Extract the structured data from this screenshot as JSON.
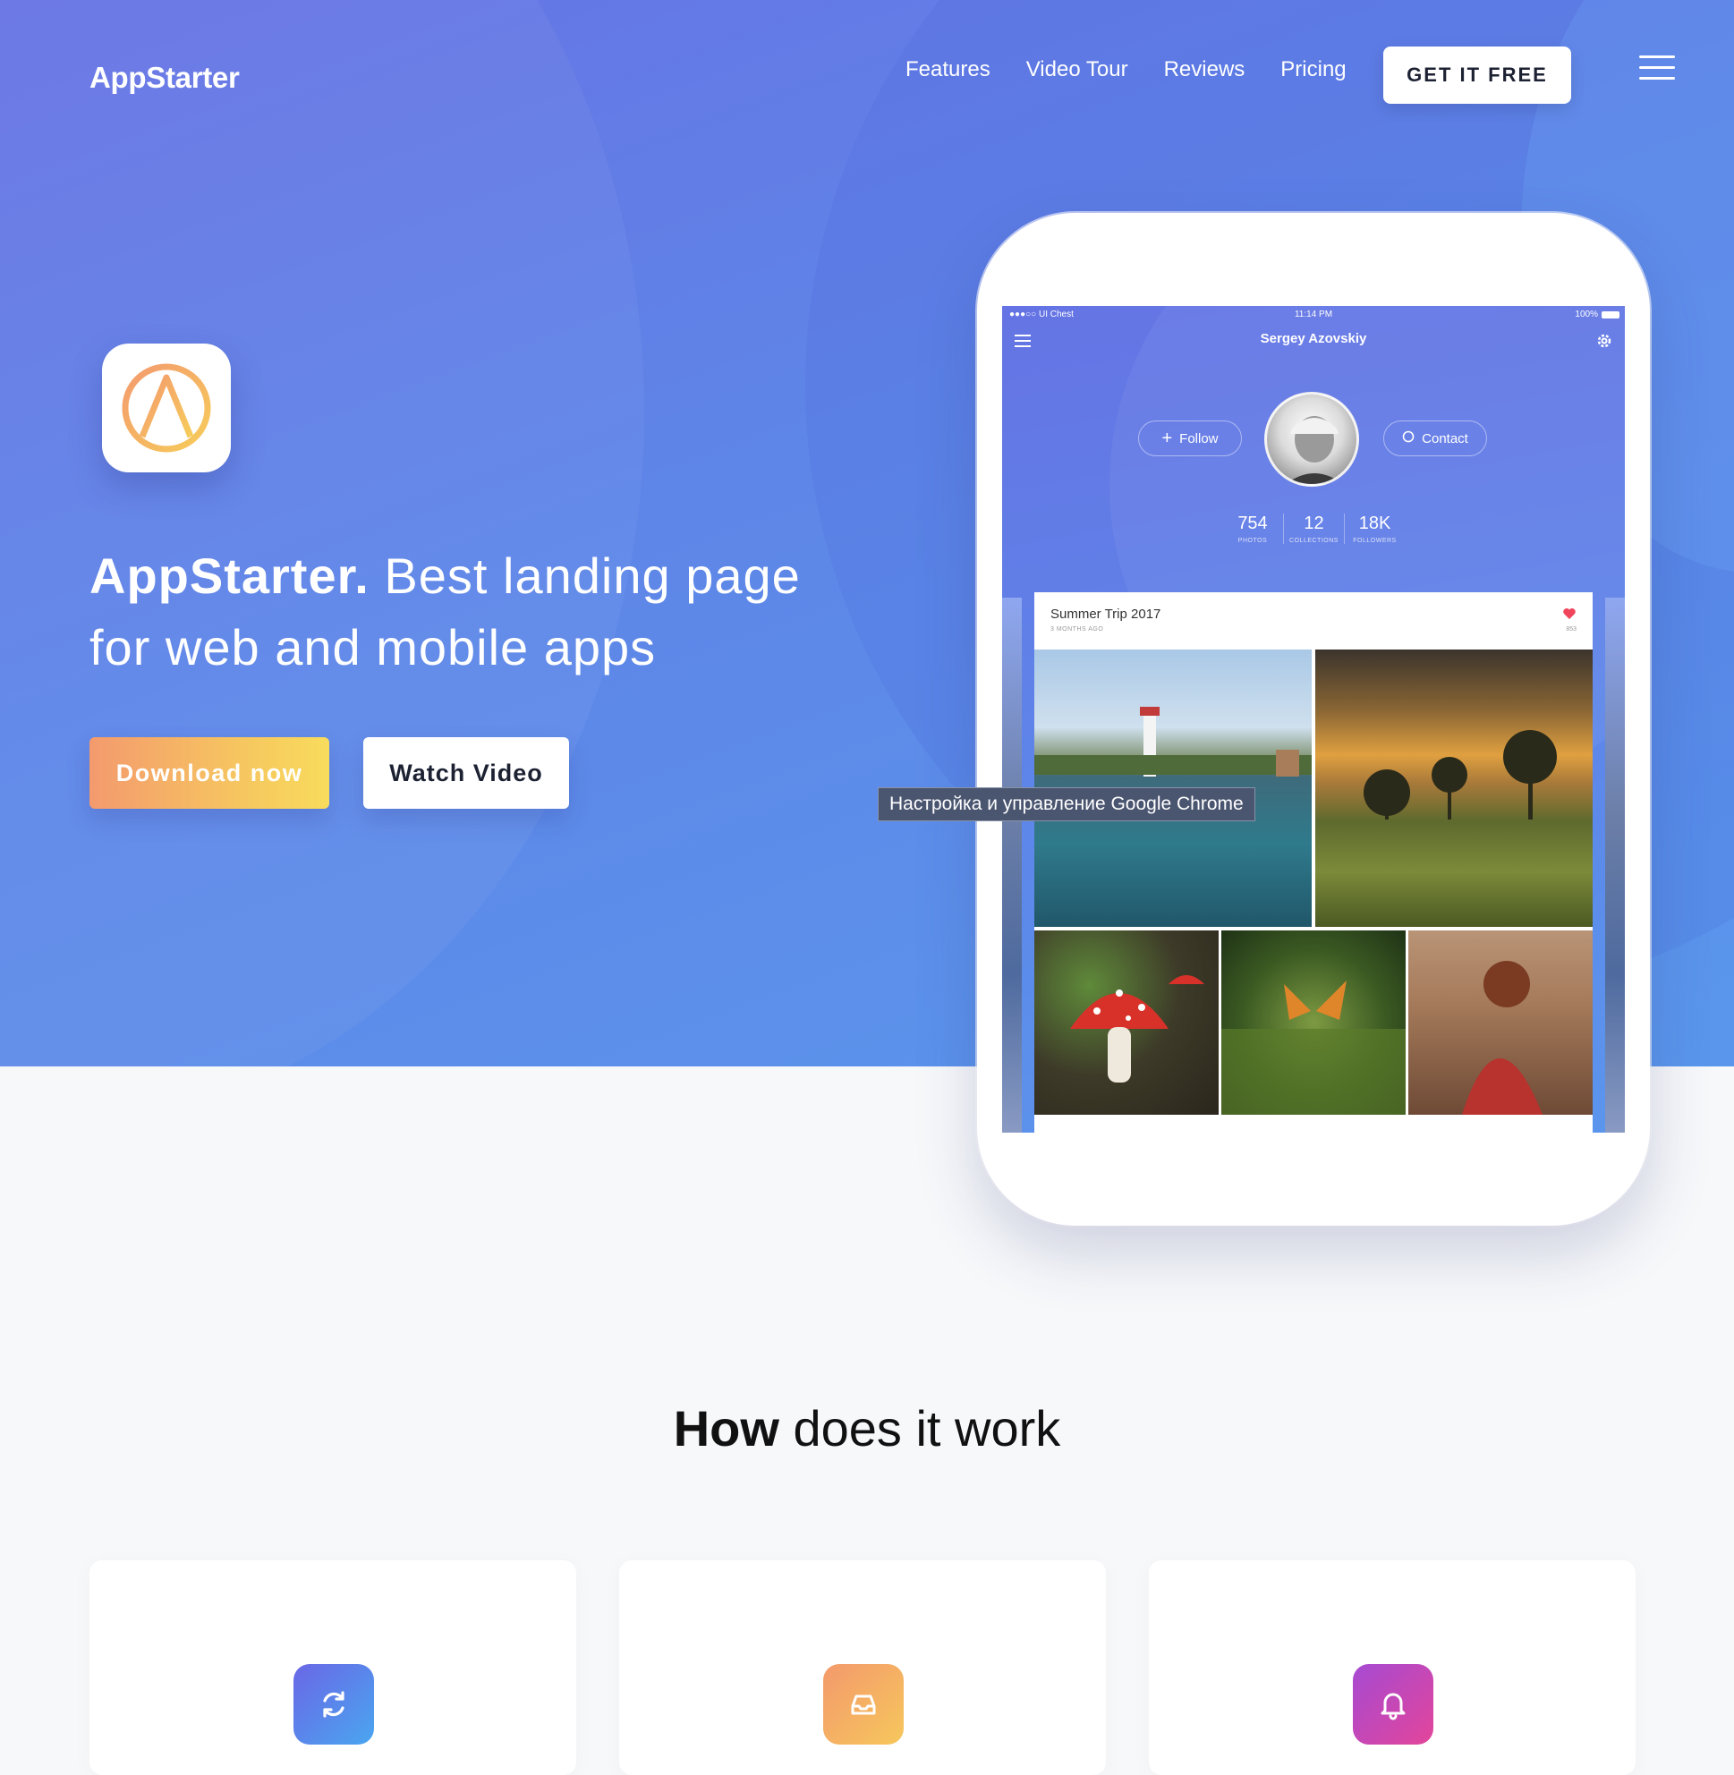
{
  "nav": {
    "logo": "AppStarter",
    "links": [
      "Features",
      "Video Tour",
      "Reviews",
      "Pricing"
    ],
    "cta": "GET IT FREE",
    "menu_icon": "hamburger-icon"
  },
  "hero": {
    "app_icon": "appstarter-logo-icon",
    "headline_bold": "AppStarter.",
    "headline_rest": " Best landing page for web and mobile apps",
    "download_label": "Download now",
    "video_label": "Watch Video"
  },
  "device": {
    "status_carrier": "●●●○○ UI Chest",
    "status_time": "11:14 PM",
    "status_battery": "100%",
    "profile_name": "Sergey Azovskiy",
    "follow_label": "Follow",
    "contact_label": "Contact",
    "stats": [
      {
        "value": "754",
        "label": "PHOTOS"
      },
      {
        "value": "12",
        "label": "COLLECTIONS"
      },
      {
        "value": "18K",
        "label": "FOLLOWERS"
      }
    ],
    "card_title": "Summer Trip 2017",
    "card_subtitle": "3 MONTHS AGO",
    "card_likes": "853"
  },
  "tooltip": "Настройка и управление Google Chrome",
  "how": {
    "title_bold": "How",
    "title_rest": " does it work"
  },
  "features": [
    {
      "icon": "sync-icon"
    },
    {
      "icon": "inbox-icon"
    },
    {
      "icon": "bell-icon"
    }
  ],
  "colors": {
    "hero_start": "#6773e4",
    "hero_end": "#5a97ec",
    "download_start": "#f49a6e",
    "download_end": "#f8dc5c",
    "page_bg": "#f7f8fa"
  }
}
